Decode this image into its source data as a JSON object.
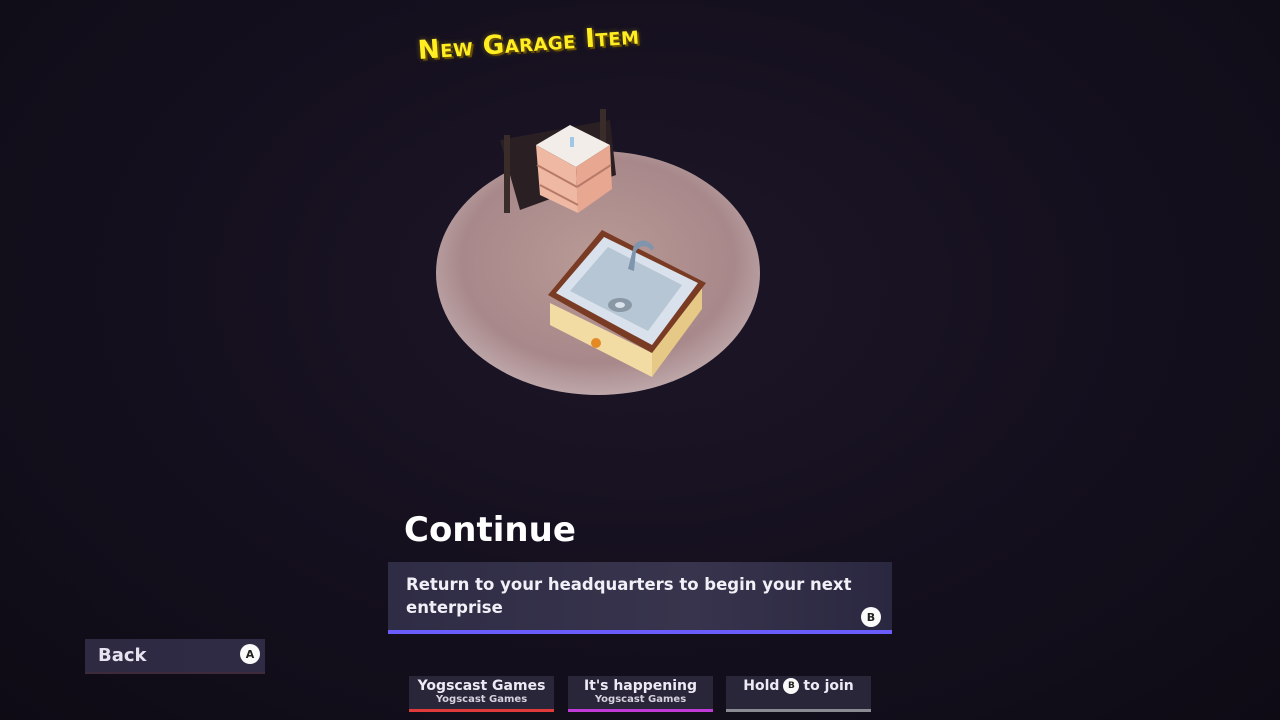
{
  "banner": {
    "text": "New Garage Item"
  },
  "screen": {
    "title": "Continue"
  },
  "description": {
    "text": "Return to your headquarters to begin your next enterprise",
    "button_glyph": "B"
  },
  "back": {
    "label": "Back",
    "button_glyph": "A"
  },
  "players": [
    {
      "name": "Yogscast Games",
      "sub": "Yogscast Games",
      "color": "#e03a3a"
    },
    {
      "name": "It's happening",
      "sub": "Yogscast Games",
      "color": "#c03ad8"
    },
    {
      "hold_text": "Hold",
      "button_glyph": "B",
      "join_text": "to join",
      "color": "#8a8a92"
    }
  ],
  "items": [
    {
      "name": "sink",
      "icon": "sink-icon"
    },
    {
      "name": "cardboard-box-crate",
      "icon": "crate-icon"
    }
  ]
}
